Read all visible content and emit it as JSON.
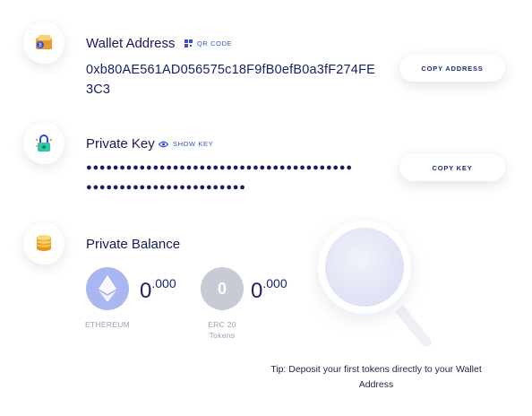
{
  "wallet": {
    "title": "Wallet Address",
    "qr_link": "QR CODE",
    "address": "0xb80AE561AD056575c18F9fB0efB0a3fF274FE3C3",
    "copy_button": "COPY ADDRESS",
    "icon": "wallet-icon"
  },
  "private_key": {
    "title": "Private Key",
    "show_link": "SHOW KEY",
    "masked_line1": "●●●●●●●●●●●●●●●●●●●●●●●●●●●●●●●●●●●●●●●●",
    "masked_line2": "●●●●●●●●●●●●●●●●●●●●●●●●",
    "copy_button": "COPY KEY",
    "icon": "padlock-icon"
  },
  "balance": {
    "title": "Private Balance",
    "icon": "coin-stack-icon",
    "coins": [
      {
        "name": "ETHEREUM",
        "int": "0",
        "dec": ".000",
        "icon": "ethereum-icon",
        "color": "#a9b6ef"
      },
      {
        "name": "ERC 20 Tokens",
        "int": "0",
        "dec": ".000",
        "glyph": "0",
        "color": "#c8cbd6"
      }
    ]
  },
  "tip": {
    "text": "Tip: Deposit your first tokens directly to your Wallet Address",
    "icon": "magnifier-icon"
  }
}
